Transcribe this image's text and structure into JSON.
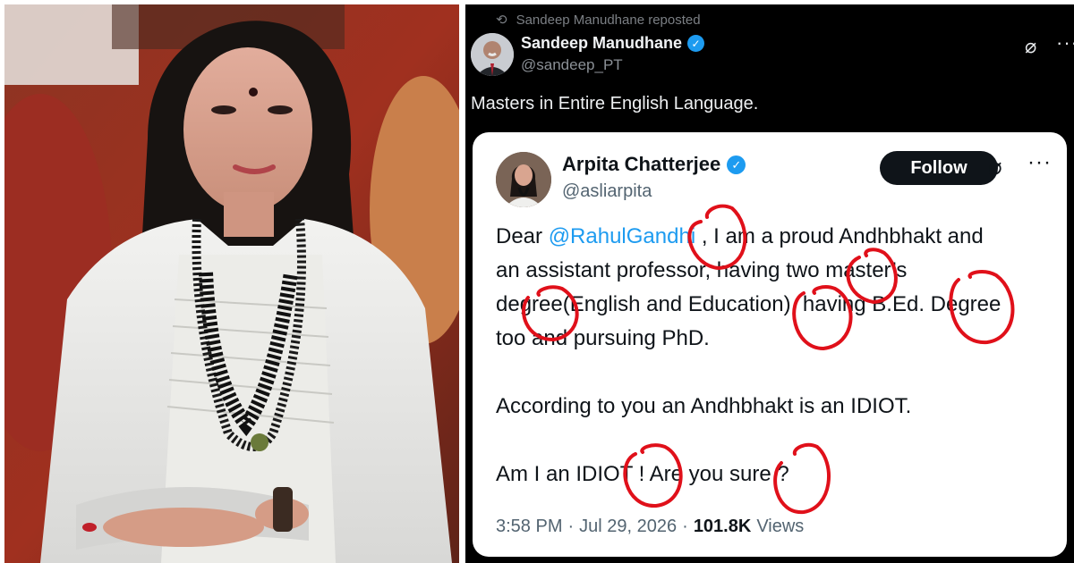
{
  "repost": {
    "text": "Sandeep Manudhane reposted",
    "icon": "repost-icon"
  },
  "outer_post": {
    "author_name": "Sandeep Manudhane",
    "author_handle": "@sandeep_PT",
    "verified": true,
    "text": "Masters in Entire English Language."
  },
  "quoted_post": {
    "author_name": "Arpita Chatterjee",
    "author_handle": "@asliarpita",
    "verified": true,
    "follow_label": "Follow",
    "body": {
      "line1_prefix": "Dear ",
      "mention": "@RahulGandhi",
      "line1_suffix": " , I am a proud Andhbhakt and",
      "line2": "an assistant professor, having two master’s",
      "line3": "degree(English and Education), having B.Ed. Degree",
      "line4": "too and pursuing PhD.",
      "line5": "According to you an Andhbhakt is an IDIOT.",
      "line6": "Am I an IDIOT ! Are you sure ?"
    },
    "time": "3:58 PM",
    "date": "Jul 29, 2026",
    "views_count": "101.8K",
    "views_label": "Views"
  },
  "colors": {
    "verified_blue": "#1d9bf0",
    "annotation_red": "#e0101a",
    "panel_black": "#000000"
  }
}
